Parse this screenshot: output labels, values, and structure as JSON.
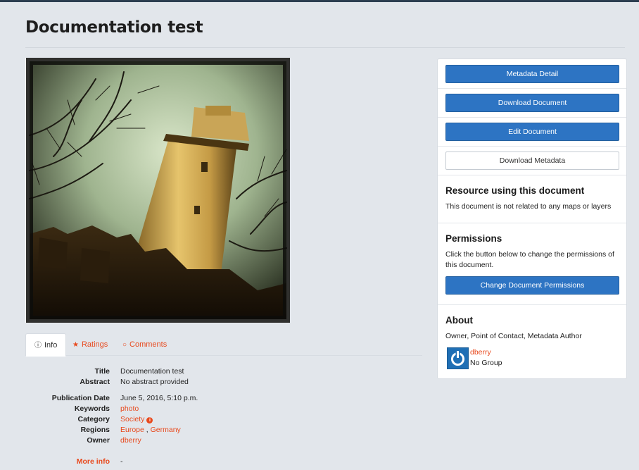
{
  "page": {
    "title": "Documentation test"
  },
  "tabs": {
    "info": "Info",
    "ratings": "Ratings",
    "comments": "Comments"
  },
  "info": {
    "title_label": "Title",
    "title_value": "Documentation test",
    "abstract_label": "Abstract",
    "abstract_value": "No abstract provided",
    "publication_date_label": "Publication Date",
    "publication_date_value": "June 5, 2016, 5:10 p.m.",
    "keywords_label": "Keywords",
    "keywords_value": "photo",
    "category_label": "Category",
    "category_value": "Society",
    "regions_label": "Regions",
    "region_1": "Europe",
    "region_separator": " , ",
    "region_2": "Germany",
    "owner_label": "Owner",
    "owner_value": "dberry",
    "more_info_label": "More info",
    "more_info_value": "-"
  },
  "sidebar": {
    "metadata_detail": "Metadata Detail",
    "download_document": "Download Document",
    "edit_document": "Edit Document",
    "download_metadata": "Download Metadata",
    "resource_title": "Resource using this document",
    "resource_text": "This document is not related to any maps or layers",
    "permissions_title": "Permissions",
    "permissions_text": "Click the button below to change the permissions of this document.",
    "change_permissions": "Change Document Permissions",
    "about_title": "About",
    "about_roles": "Owner, Point of Contact, Metadata Author",
    "owner_name": "dberry",
    "owner_group": "No Group"
  },
  "colors": {
    "accent": "#e8491d",
    "primary_button": "#2d74c3",
    "background": "#e2e6eb"
  },
  "icons": {
    "info_tab": "info-circle-icon",
    "ratings_tab": "star-icon",
    "comments_tab": "comment-icon",
    "category": "info-circle-icon",
    "avatar": "power-icon"
  }
}
